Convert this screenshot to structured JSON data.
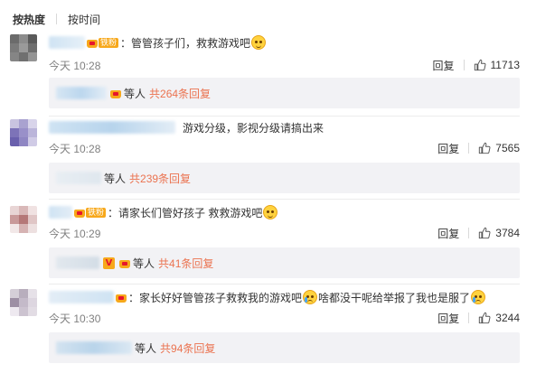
{
  "sort_tabs": {
    "hot": "按热度",
    "time": "按时间"
  },
  "comments": [
    {
      "text": "：管管孩子们，救救游戏吧",
      "fan_label": "铁粉",
      "time": "今天 10:28",
      "reply_label": "回复",
      "likes": "11713",
      "replies_who": "等人",
      "replies_count": "共264条回复"
    },
    {
      "text": "游戏分级，影视分级请搞出来",
      "time": "今天 10:28",
      "reply_label": "回复",
      "likes": "7565",
      "replies_who": "等人",
      "replies_count": "共239条回复"
    },
    {
      "text": "：请家长们管好孩子 救救游戏吧",
      "fan_label": "铁粉",
      "time": "今天 10:29",
      "reply_label": "回复",
      "likes": "3784",
      "replies_badge": "V",
      "replies_who": "等人",
      "replies_count": "共41条回复"
    },
    {
      "text": "：家长好好管管孩子救救我的游戏吧",
      "text2": "啥都没干呢给举报了我也是服了",
      "time": "今天 10:30",
      "reply_label": "回复",
      "likes": "3244",
      "replies_who": "等人",
      "replies_count": "共94条回复"
    }
  ],
  "colors": {
    "link": "#eb7350",
    "reply_bg": "#f2f2f5",
    "meta": "#808080",
    "badge": "#f7a81b"
  },
  "icons": {
    "like": "thumbs-up-icon",
    "fan": "crown-icon",
    "emoji": "smile-emoji-icon",
    "cry_emoji": "cry-emoji-icon"
  }
}
